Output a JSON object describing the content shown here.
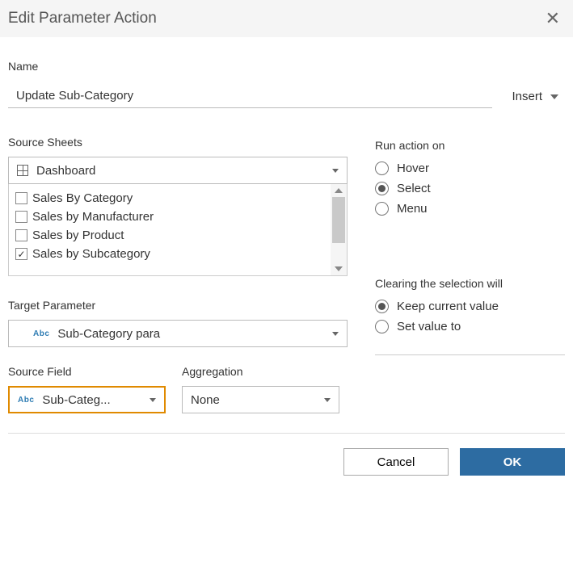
{
  "dialog": {
    "title": "Edit Parameter Action"
  },
  "name": {
    "label": "Name",
    "value": "Update Sub-Category",
    "insert_label": "Insert"
  },
  "source_sheets": {
    "label": "Source Sheets",
    "selected": "Dashboard",
    "items": [
      {
        "label": "Sales By Category",
        "checked": false
      },
      {
        "label": "Sales by Manufacturer",
        "checked": false
      },
      {
        "label": "Sales by Product",
        "checked": false
      },
      {
        "label": "Sales by Subcategory",
        "checked": true
      }
    ]
  },
  "run_on": {
    "label": "Run action on",
    "options": [
      {
        "label": "Hover",
        "selected": false
      },
      {
        "label": "Select",
        "selected": true
      },
      {
        "label": "Menu",
        "selected": false
      }
    ]
  },
  "target_param": {
    "label": "Target Parameter",
    "value": "Sub-Category para"
  },
  "clearing": {
    "label": "Clearing the selection will",
    "options": [
      {
        "label": "Keep current value",
        "selected": true
      },
      {
        "label": "Set value to",
        "selected": false
      }
    ]
  },
  "source_field": {
    "label": "Source Field",
    "value": "Sub-Categ..."
  },
  "aggregation": {
    "label": "Aggregation",
    "value": "None"
  },
  "footer": {
    "cancel": "Cancel",
    "ok": "OK"
  }
}
